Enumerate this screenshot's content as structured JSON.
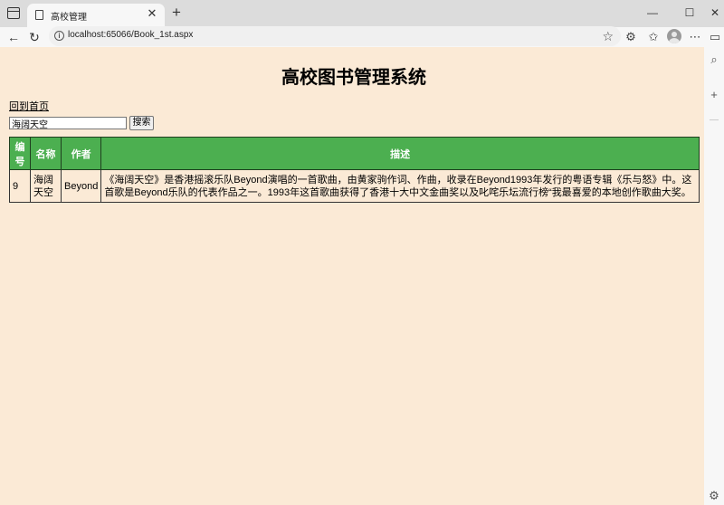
{
  "browser": {
    "tab_title": "高校管理",
    "tab_close": "✕",
    "new_tab": "+",
    "url": "localhost:65066/Book_1st.aspx",
    "window_controls": {
      "minimize": "—",
      "maximize": "☐",
      "close": "✕"
    },
    "icons": [
      "window-icon",
      "document-icon",
      "back-icon",
      "refresh-icon",
      "info-icon",
      "star-icon",
      "extensions-icon",
      "favorites-icon",
      "avatar",
      "more-icon",
      "sidebar-icon",
      "search-icon",
      "add-icon",
      "settings-icon"
    ]
  },
  "page": {
    "title": "高校图书管理系统",
    "home_link": "回到首页",
    "search": {
      "value": "海阔天空",
      "button_label": "搜索"
    },
    "table": {
      "headers": [
        "编号",
        "名称",
        "作者",
        "描述"
      ],
      "rows": [
        {
          "id": "9",
          "name": "海阔天空",
          "author": "Beyond",
          "description": "《海阔天空》是香港摇滚乐队Beyond演唱的一首歌曲，由黄家驹作词、作曲，收录在Beyond1993年发行的粤语专辑《乐与怒》中。这首歌是Beyond乐队的代表作品之一。1993年这首歌曲获得了香港十大中文金曲奖以及叱咤乐坛流行榜“我最喜爱的本地创作歌曲大奖。"
        }
      ]
    }
  },
  "colors": {
    "page_background": "#fbead6",
    "table_header": "#4caf50",
    "browser_chrome": "#dcdcdc"
  }
}
